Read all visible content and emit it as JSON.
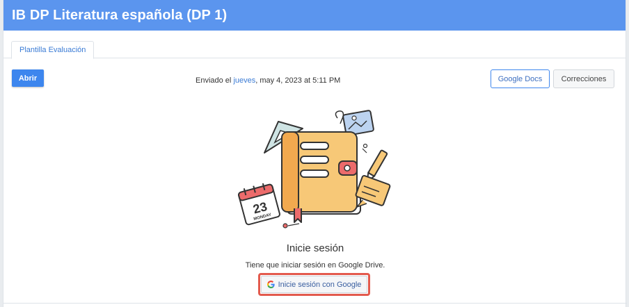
{
  "header": {
    "title": "IB DP Literatura española (DP 1)"
  },
  "tabs": [
    {
      "label": "Plantilla Evaluación"
    }
  ],
  "toolbar": {
    "open_label": "Abrir",
    "sent_prefix": "Enviado el",
    "sent_day": "jueves",
    "sent_rest": ", may 4, 2023 at 5:11 PM",
    "google_docs_label": "Google Docs",
    "corrections_label": "Correcciones"
  },
  "illustration": {
    "calendar_day": "23",
    "calendar_weekday": "MONDAY"
  },
  "login": {
    "title": "Inicie sesión",
    "text": "Tiene que iniciar sesión en Google Drive.",
    "button_label": "Inicie sesión con Google",
    "button_icon": "google-g-icon"
  },
  "colors": {
    "header_bg": "#5b95ee",
    "primary": "#3d86ee",
    "highlight": "#e35a4d"
  }
}
